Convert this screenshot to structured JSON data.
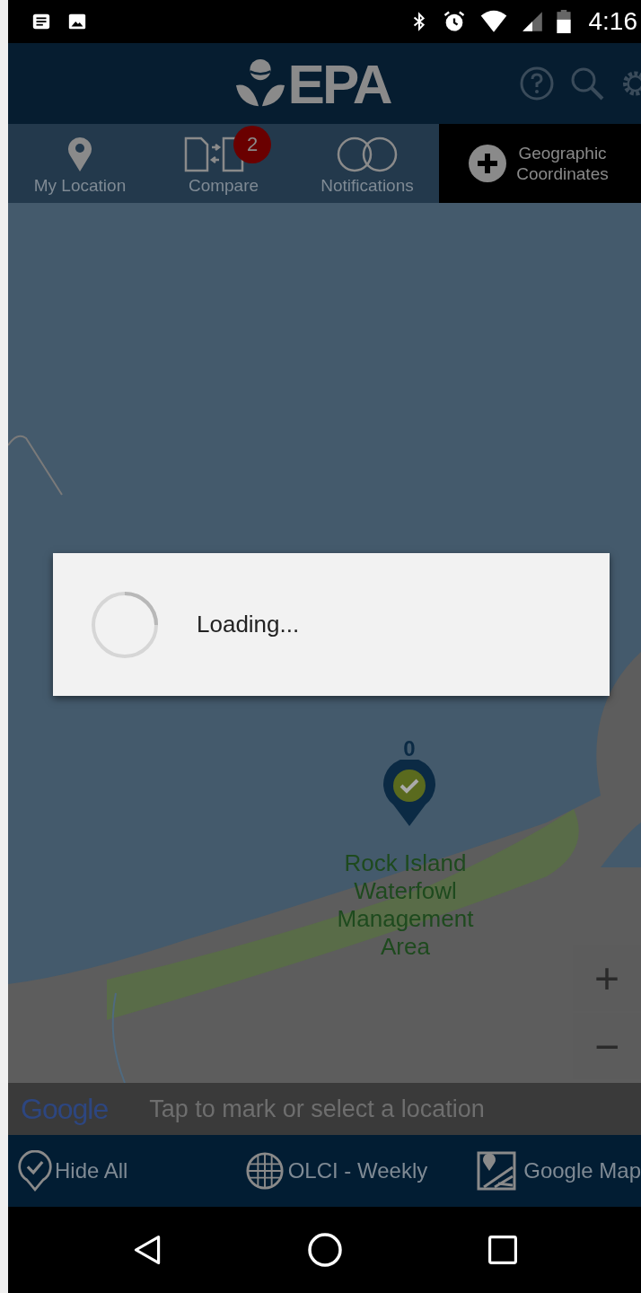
{
  "status_bar": {
    "time": "4:16"
  },
  "header": {
    "logo": "EPA"
  },
  "tabs": [
    {
      "label": "My Location",
      "kind": "pin",
      "selected": false
    },
    {
      "label": "Compare",
      "kind": "compare",
      "badge": "2",
      "selected": false
    },
    {
      "label": "Notifications",
      "kind": "rings",
      "selected": false
    },
    {
      "label": "Geographic Coordinates",
      "kind": "plus",
      "selected": true
    }
  ],
  "map": {
    "marker": {
      "count": "0"
    },
    "place_label": "Rock Island Waterfowl Management Area",
    "zoom_in": "+",
    "zoom_out": "−",
    "attribution": "Google",
    "hint": "Tap to mark or select a location"
  },
  "dialog": {
    "message": "Loading..."
  },
  "bottom_bar": [
    {
      "label": "Hide All",
      "kind": "check"
    },
    {
      "label": "OLCI - Weekly",
      "kind": "grid"
    },
    {
      "label": "Google Map",
      "kind": "map"
    }
  ]
}
